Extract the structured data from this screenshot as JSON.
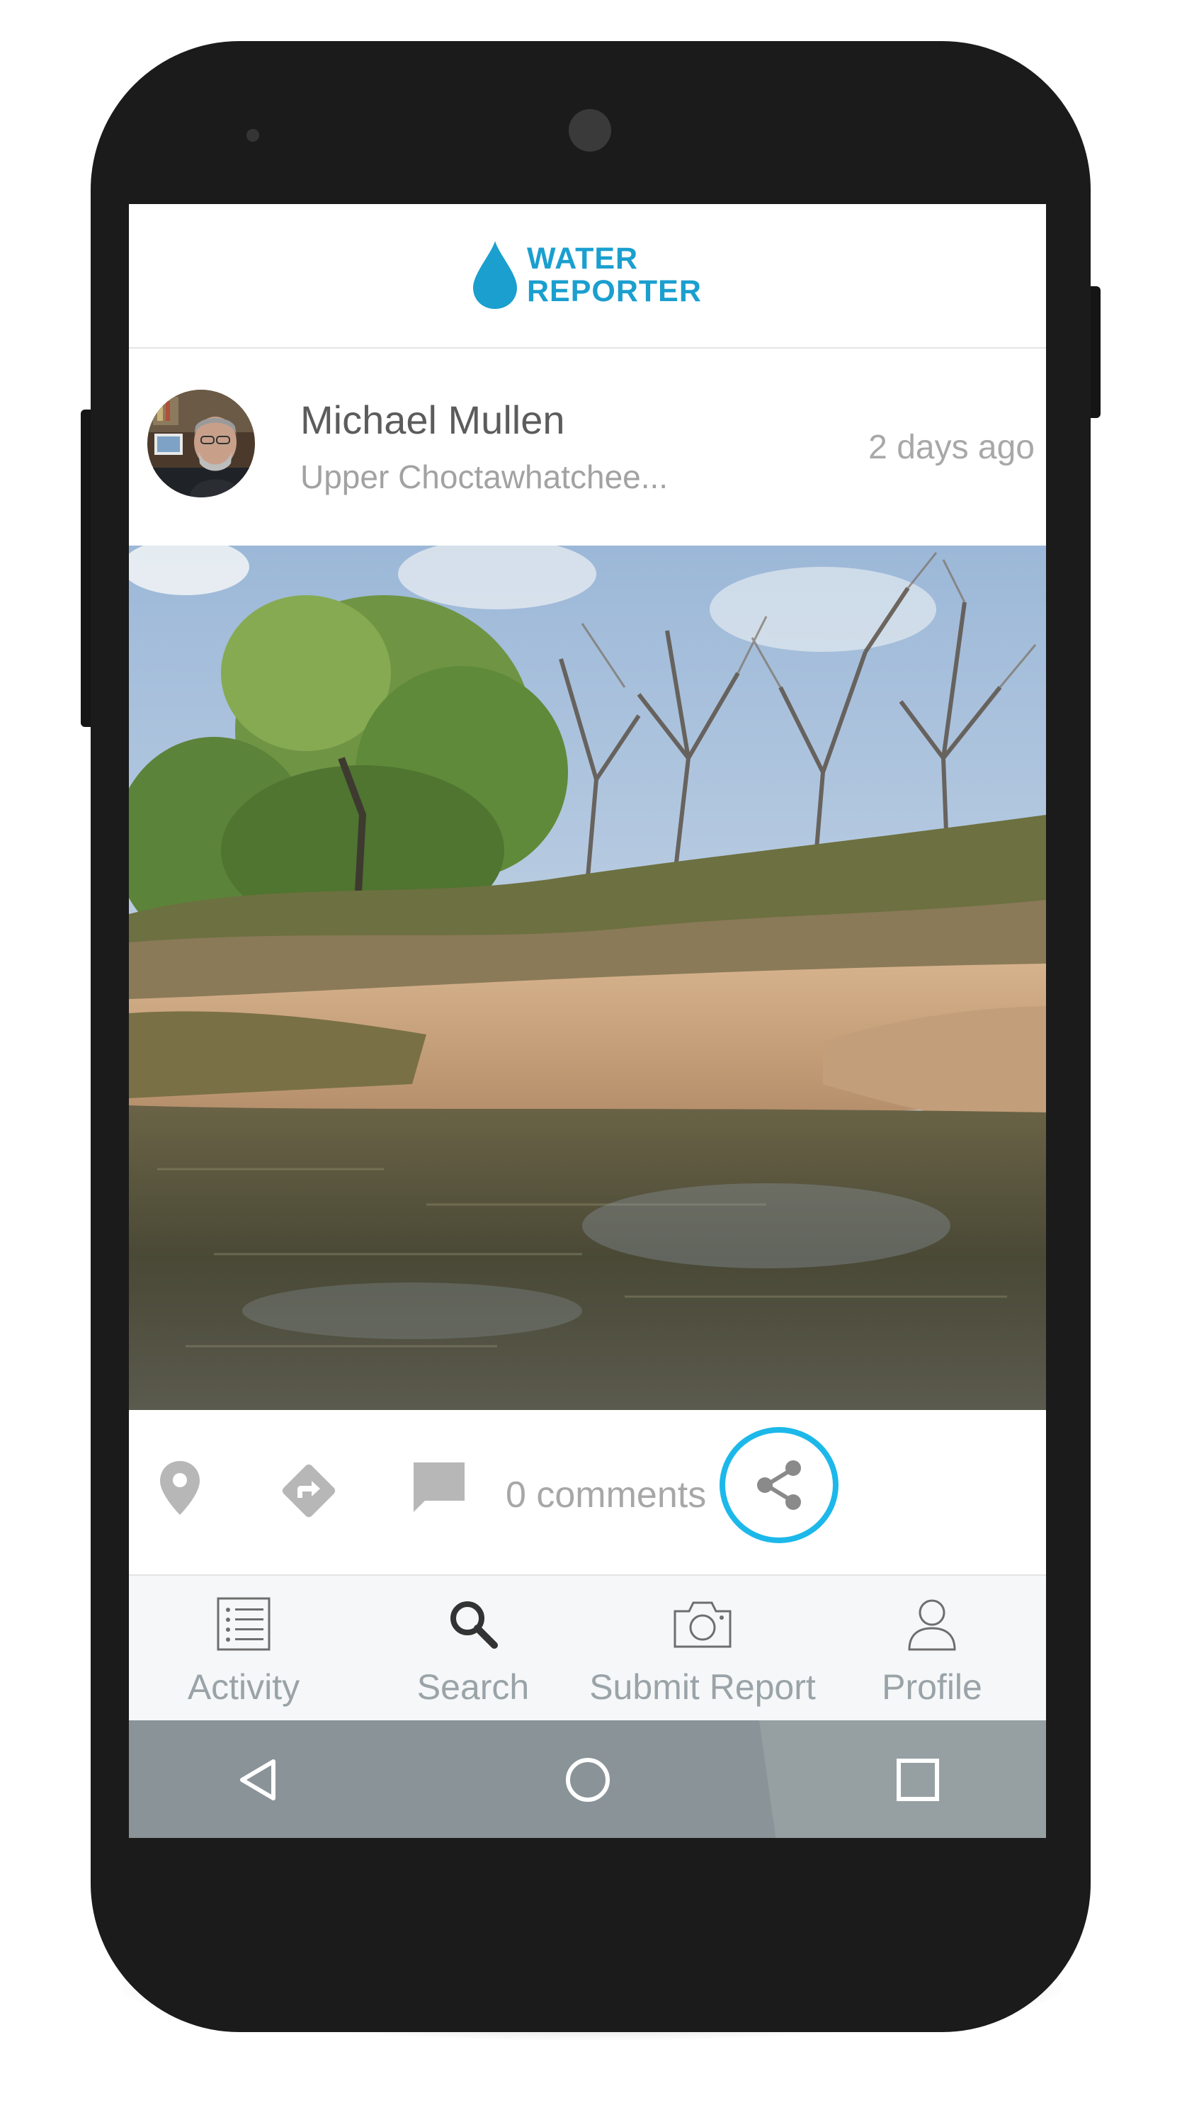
{
  "app": {
    "logo_line1": "WATER",
    "logo_line2": "REPORTER",
    "brand_color": "#1a9fcf"
  },
  "post": {
    "author_name": "Michael Mullen",
    "location": "Upper Choctawhatchee...",
    "time": "2 days ago",
    "photo_subject": "river-sandbar-photo"
  },
  "actions": {
    "icons": [
      "location-pin-icon",
      "directions-icon",
      "comment-icon",
      "share-icon"
    ],
    "comments_label": "0 comments",
    "highlight_color": "#1cb8ea"
  },
  "tabs": [
    {
      "label": "Activity",
      "icon": "activity-list-icon"
    },
    {
      "label": "Search",
      "icon": "search-icon"
    },
    {
      "label": "Submit Report",
      "icon": "camera-icon"
    },
    {
      "label": "Profile",
      "icon": "profile-icon"
    }
  ],
  "android_nav": {
    "buttons": [
      "back-icon",
      "home-icon",
      "recents-icon"
    ]
  }
}
